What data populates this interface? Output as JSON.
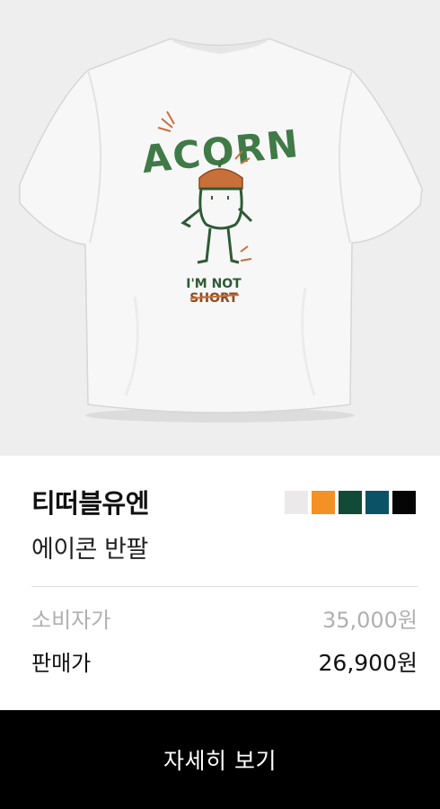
{
  "product": {
    "brand": "티떠블유엔",
    "name": "에이콘 반팔",
    "colors": [
      "#ebe9ea",
      "#f59025",
      "#114a36",
      "#0c5266",
      "#050505"
    ],
    "image": {
      "print_title": "ACORN",
      "print_caption_line1": "I'M NOT",
      "print_caption_line2": "SHORT"
    }
  },
  "pricing": {
    "list_label": "소비자가",
    "list_price": "35,000원",
    "sale_label": "판매가",
    "sale_price": "26,900원"
  },
  "cta": {
    "label": "자세히 보기"
  }
}
